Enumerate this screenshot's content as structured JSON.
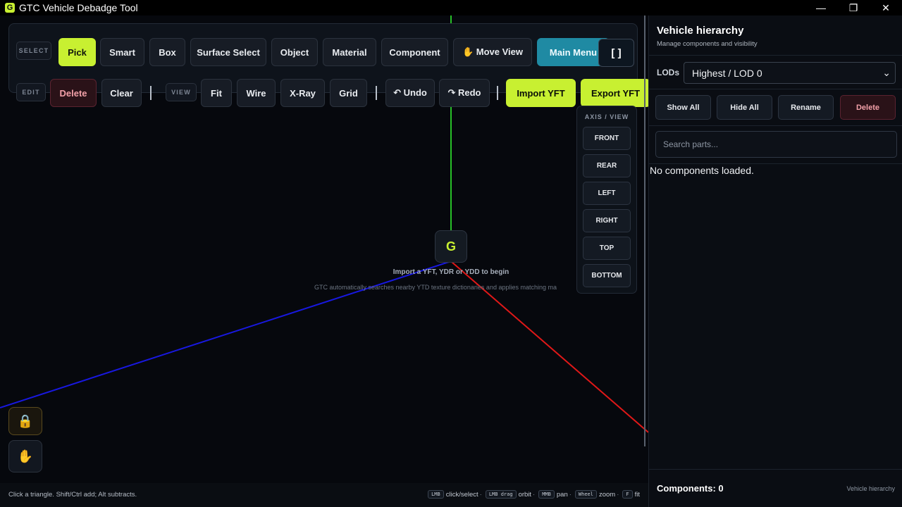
{
  "window": {
    "title": "GTC Vehicle Debadge Tool",
    "logo_letter": "G",
    "minimize": "—",
    "restore": "❐",
    "close": "✕"
  },
  "toolbar": {
    "select_tag": "SELECT",
    "edit_tag": "EDIT",
    "view_tag": "VIEW",
    "pick": "Pick",
    "smart": "Smart",
    "box": "Box",
    "surface_select": "Surface Select",
    "object": "Object",
    "material": "Material",
    "component": "Component",
    "move_view": "✋ Move View",
    "main_menu": "Main Menu",
    "fullscreen": "[ ]",
    "delete": "Delete",
    "clear": "Clear",
    "fit": "Fit",
    "wire": "Wire",
    "xray": "X-Ray",
    "grid": "Grid",
    "undo": "↶ Undo",
    "redo": "↷ Redo",
    "import_yft": "Import YFT",
    "export_yft": "Export YFT"
  },
  "axis_view": {
    "title": "AXIS / VIEW",
    "front": "FRONT",
    "rear": "REAR",
    "left": "LEFT",
    "right": "RIGHT",
    "top": "TOP",
    "bottom": "BOTTOM"
  },
  "empty_state": {
    "logo": "G",
    "title": "Import a YFT, YDR or YDD to begin",
    "subtitle": "GTC automatically searches nearby YTD texture dictionaries and applies matching ma"
  },
  "floating": {
    "lock_icon": "🔒",
    "hand_icon": "✋"
  },
  "status": {
    "hint": "Click a triangle. Shift/Ctrl add; Alt subtracts.",
    "lmb": "LMB",
    "click_select": "click/select",
    "lmb_drag": "LMB drag",
    "orbit": "orbit",
    "mmb": "MMB",
    "pan": "pan",
    "wheel": "Wheel",
    "zoom": "zoom",
    "f_key": "F",
    "fit": "fit",
    "sep": "·"
  },
  "panel": {
    "title": "Vehicle hierarchy",
    "subtitle": "Manage components and visibility",
    "lods_label": "LODs",
    "lod_selected": "Highest / LOD 0",
    "show_all": "Show All",
    "hide_all": "Hide All",
    "rename": "Rename",
    "delete": "Delete",
    "search_placeholder": "Search parts...",
    "empty": "No components loaded.",
    "components_count": "Components: 0",
    "footer": "Vehicle hierarchy"
  },
  "colors": {
    "accent": "#c8f031",
    "teal": "#1f8aa3",
    "axis_x": "#e01818",
    "axis_y": "#28c028",
    "axis_z": "#1818e0"
  }
}
